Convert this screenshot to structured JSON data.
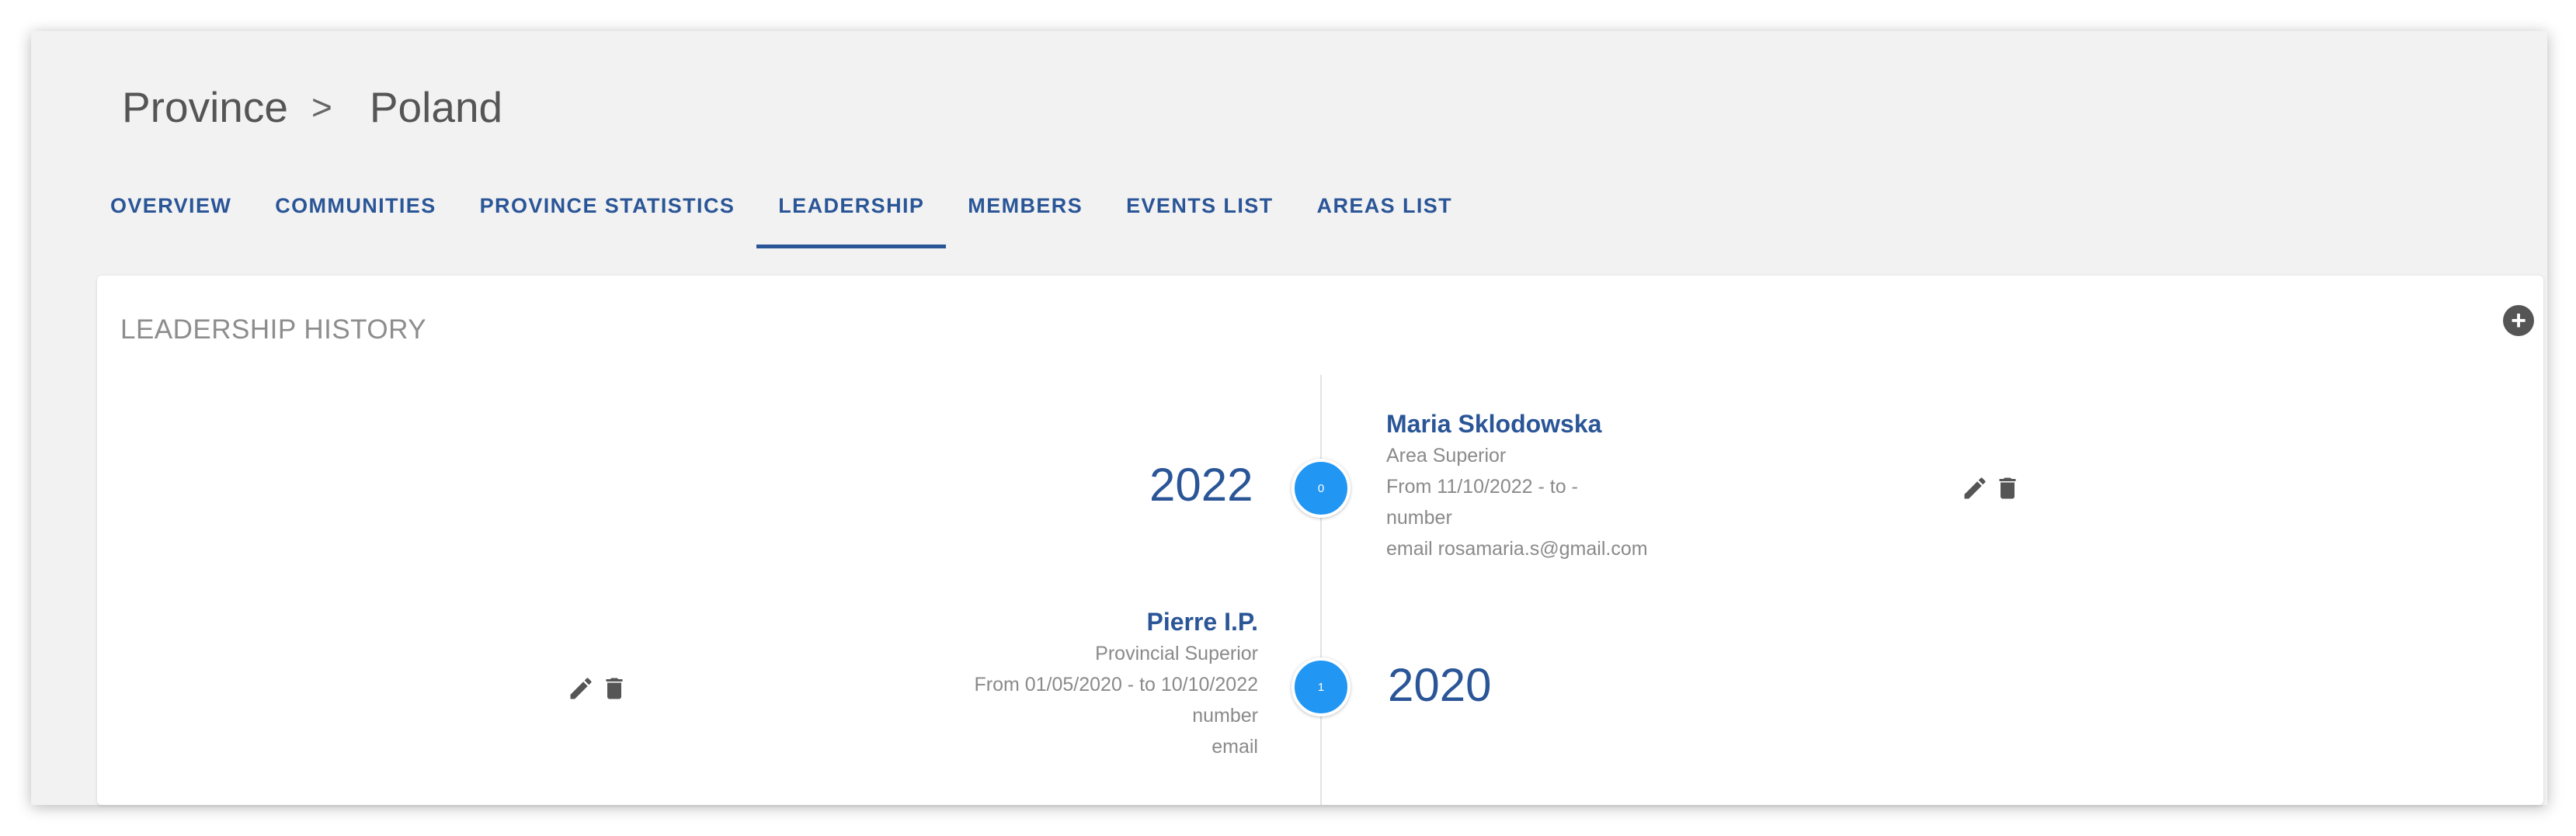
{
  "breadcrumb": {
    "parent": "Province",
    "separator": ">",
    "current": "Poland"
  },
  "tabs": [
    {
      "label": "OVERVIEW",
      "active": false
    },
    {
      "label": "COMMUNITIES",
      "active": false
    },
    {
      "label": "PROVINCE STATISTICS",
      "active": false
    },
    {
      "label": "LEADERSHIP",
      "active": true
    },
    {
      "label": "MEMBERS",
      "active": false
    },
    {
      "label": "EVENTS LIST",
      "active": false
    },
    {
      "label": "AREAS LIST",
      "active": false
    }
  ],
  "card": {
    "title": "LEADERSHIP HISTORY",
    "add_icon": "plus-circle-icon"
  },
  "timeline": [
    {
      "index": "0",
      "year": "2022",
      "name": "Maria Sklodowska",
      "role": "Area Superior",
      "period": "From 11/10/2022 - to -",
      "number": "number",
      "email": "email rosamaria.s@gmail.com"
    },
    {
      "index": "1",
      "year": "2020",
      "name": "Pierre I.P.",
      "role": "Provincial Superior",
      "period": "From 01/05/2020 - to 10/10/2022",
      "number": "number",
      "email": "email"
    }
  ],
  "colors": {
    "accent": "#2a5597",
    "timeline_dot": "#2196f3",
    "background": "#f2f2f2",
    "muted_text": "#8a8a8a"
  },
  "icons": {
    "edit": "pencil-icon",
    "delete": "trash-icon"
  }
}
